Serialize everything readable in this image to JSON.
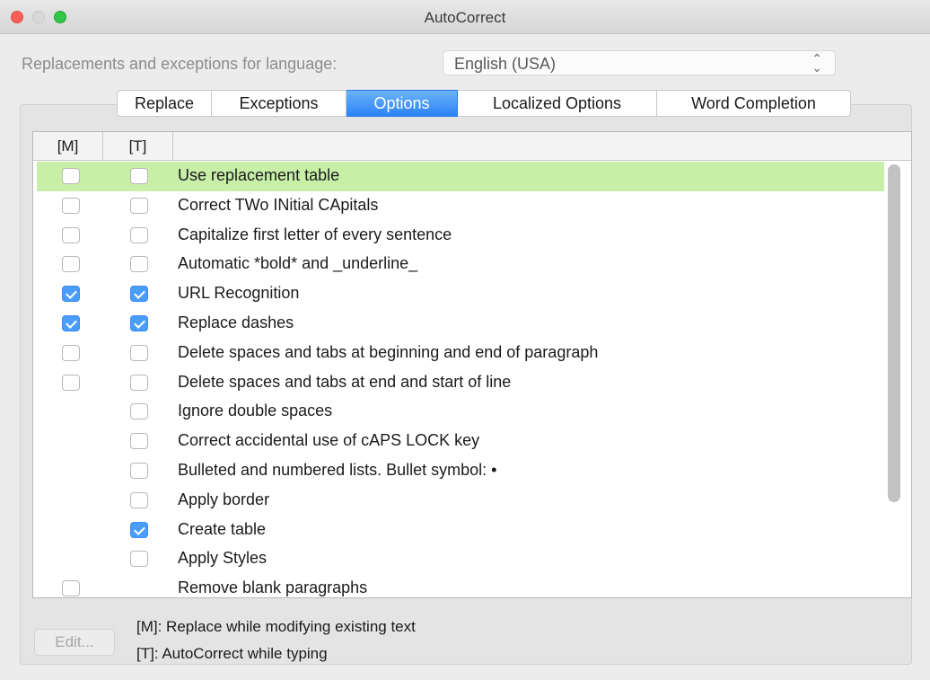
{
  "window": {
    "title": "AutoCorrect"
  },
  "language": {
    "label": "Replacements and exceptions for language:",
    "value": "English (USA)",
    "arrows_icon": "up-down-chevron-icon"
  },
  "tabs": [
    {
      "label": "Replace",
      "active": false
    },
    {
      "label": "Exceptions",
      "active": false
    },
    {
      "label": "Options",
      "active": true
    },
    {
      "label": "Localized Options",
      "active": false
    },
    {
      "label": "Word Completion",
      "active": false
    }
  ],
  "columns": {
    "m": "[M]",
    "t": "[T]",
    "label": ""
  },
  "rows": [
    {
      "m": false,
      "t": false,
      "label": "Use replacement table",
      "selected": true
    },
    {
      "m": false,
      "t": false,
      "label": "Correct TWo INitial CApitals"
    },
    {
      "m": false,
      "t": false,
      "label": "Capitalize first letter of every sentence"
    },
    {
      "m": false,
      "t": false,
      "label": "Automatic *bold* and _underline_"
    },
    {
      "m": true,
      "t": true,
      "label": "URL Recognition"
    },
    {
      "m": true,
      "t": true,
      "label": "Replace dashes"
    },
    {
      "m": false,
      "t": false,
      "label": "Delete spaces and tabs at beginning and end of paragraph"
    },
    {
      "m": false,
      "t": false,
      "label": "Delete spaces and tabs at end and start of line"
    },
    {
      "m": null,
      "t": false,
      "label": "Ignore double spaces"
    },
    {
      "m": null,
      "t": false,
      "label": "Correct accidental use of cAPS LOCK key"
    },
    {
      "m": null,
      "t": false,
      "label": "Bulleted and numbered lists. Bullet symbol: •"
    },
    {
      "m": null,
      "t": false,
      "label": "Apply border"
    },
    {
      "m": null,
      "t": true,
      "label": "Create table"
    },
    {
      "m": null,
      "t": false,
      "label": "Apply Styles"
    },
    {
      "m": false,
      "t": null,
      "label": "Remove blank paragraphs"
    }
  ],
  "edit_button": {
    "label": "Edit...",
    "enabled": false
  },
  "legend": {
    "m": "[M]: Replace while modifying existing text",
    "t": "[T]: AutoCorrect while typing"
  },
  "colors": {
    "selected_row": "#c7efa8",
    "active_tab": "#2a83f6",
    "checked": "#4a9dfb"
  }
}
